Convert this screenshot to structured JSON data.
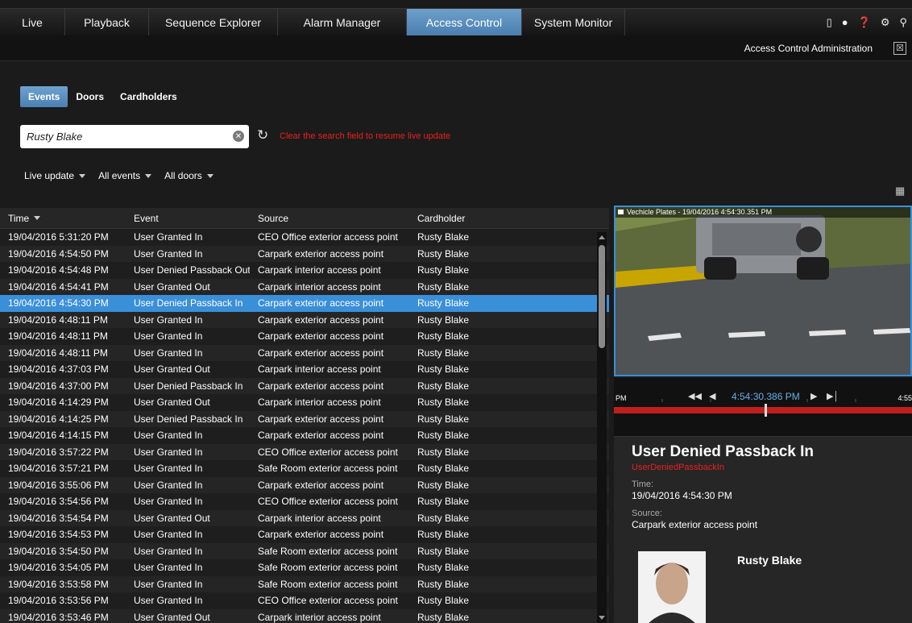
{
  "nav": {
    "tabs": [
      {
        "label": "Live"
      },
      {
        "label": "Playback"
      },
      {
        "label": "Sequence Explorer"
      },
      {
        "label": "Alarm Manager"
      },
      {
        "label": "Access Control"
      },
      {
        "label": "System Monitor"
      }
    ],
    "active": "Access Control"
  },
  "header": {
    "title": "Access Control Administration"
  },
  "subtabs": {
    "events": "Events",
    "doors": "Doors",
    "cardholders": "Cardholders"
  },
  "search": {
    "value": "Rusty Blake",
    "hint": "Clear the search field to resume live update"
  },
  "filters": {
    "live_update": "Live update",
    "all_events": "All events",
    "all_doors": "All doors"
  },
  "table": {
    "headers": {
      "time": "Time",
      "event": "Event",
      "source": "Source",
      "cardholder": "Cardholder"
    },
    "rows": [
      {
        "time": "19/04/2016 5:31:20 PM",
        "event": "User Granted In",
        "source": "CEO Office exterior access point",
        "cardholder": "Rusty Blake"
      },
      {
        "time": "19/04/2016 4:54:50 PM",
        "event": "User Granted In",
        "source": "Carpark exterior access point",
        "cardholder": "Rusty Blake"
      },
      {
        "time": "19/04/2016 4:54:48 PM",
        "event": "User Denied Passback Out",
        "source": "Carpark interior access point",
        "cardholder": "Rusty Blake"
      },
      {
        "time": "19/04/2016 4:54:41 PM",
        "event": "User Granted Out",
        "source": "Carpark interior access point",
        "cardholder": "Rusty Blake"
      },
      {
        "time": "19/04/2016 4:54:30 PM",
        "event": "User Denied Passback In",
        "source": "Carpark exterior access point",
        "cardholder": "Rusty Blake"
      },
      {
        "time": "19/04/2016 4:48:11 PM",
        "event": "User Granted In",
        "source": "Carpark exterior access point",
        "cardholder": "Rusty Blake"
      },
      {
        "time": "19/04/2016 4:48:11 PM",
        "event": "User Granted In",
        "source": "Carpark exterior access point",
        "cardholder": "Rusty Blake"
      },
      {
        "time": "19/04/2016 4:48:11 PM",
        "event": "User Granted In",
        "source": "Carpark exterior access point",
        "cardholder": "Rusty Blake"
      },
      {
        "time": "19/04/2016 4:37:03 PM",
        "event": "User Granted Out",
        "source": "Carpark interior access point",
        "cardholder": "Rusty Blake"
      },
      {
        "time": "19/04/2016 4:37:00 PM",
        "event": "User Denied Passback In",
        "source": "Carpark exterior access point",
        "cardholder": "Rusty Blake"
      },
      {
        "time": "19/04/2016 4:14:29 PM",
        "event": "User Granted Out",
        "source": "Carpark interior access point",
        "cardholder": "Rusty Blake"
      },
      {
        "time": "19/04/2016 4:14:25 PM",
        "event": "User Denied Passback In",
        "source": "Carpark exterior access point",
        "cardholder": "Rusty Blake"
      },
      {
        "time": "19/04/2016 4:14:15 PM",
        "event": "User Granted In",
        "source": "Carpark exterior access point",
        "cardholder": "Rusty Blake"
      },
      {
        "time": "19/04/2016 3:57:22 PM",
        "event": "User Granted In",
        "source": "CEO Office exterior access point",
        "cardholder": "Rusty Blake"
      },
      {
        "time": "19/04/2016 3:57:21 PM",
        "event": "User Granted In",
        "source": "Safe Room exterior access point",
        "cardholder": "Rusty Blake"
      },
      {
        "time": "19/04/2016 3:55:06 PM",
        "event": "User Granted In",
        "source": "Carpark exterior access point",
        "cardholder": "Rusty Blake"
      },
      {
        "time": "19/04/2016 3:54:56 PM",
        "event": "User Granted In",
        "source": "CEO Office exterior access point",
        "cardholder": "Rusty Blake"
      },
      {
        "time": "19/04/2016 3:54:54 PM",
        "event": "User Granted Out",
        "source": "Carpark interior access point",
        "cardholder": "Rusty Blake"
      },
      {
        "time": "19/04/2016 3:54:53 PM",
        "event": "User Granted In",
        "source": "Carpark exterior access point",
        "cardholder": "Rusty Blake"
      },
      {
        "time": "19/04/2016 3:54:50 PM",
        "event": "User Granted In",
        "source": "Safe Room exterior access point",
        "cardholder": "Rusty Blake"
      },
      {
        "time": "19/04/2016 3:54:05 PM",
        "event": "User Granted In",
        "source": "Safe Room exterior access point",
        "cardholder": "Rusty Blake"
      },
      {
        "time": "19/04/2016 3:53:58 PM",
        "event": "User Granted In",
        "source": "Safe Room exterior access point",
        "cardholder": "Rusty Blake"
      },
      {
        "time": "19/04/2016 3:53:56 PM",
        "event": "User Granted In",
        "source": "CEO Office exterior access point",
        "cardholder": "Rusty Blake"
      },
      {
        "time": "19/04/2016 3:53:46 PM",
        "event": "User Granted Out",
        "source": "Carpark interior access point",
        "cardholder": "Rusty Blake"
      }
    ],
    "selected_index": 4
  },
  "video": {
    "title": "Vechicle Plates - 19/04/2016 4:54:30.351 PM"
  },
  "timeline": {
    "left_label": "PM",
    "right_label": "4:55",
    "current_time": "4:54:30.386 PM"
  },
  "details": {
    "event_title": "User Denied Passback In",
    "event_code": "UserDeniedPassbackIn",
    "time_label": "Time:",
    "time_value": "19/04/2016 4:54:30 PM",
    "source_label": "Source:",
    "source_value": "Carpark exterior access point",
    "cardholder_name": "Rusty Blake"
  },
  "icons": [
    "plug-icon",
    "pin-icon",
    "help-icon",
    "gear-icon",
    "key-icon",
    "maximize-icon",
    "refresh-icon",
    "clear-icon",
    "layout-icon",
    "camera-icon"
  ],
  "colors": {
    "accent": "#3a8fd9",
    "warning": "#e8201e",
    "timeline_red": "#c0201d"
  }
}
